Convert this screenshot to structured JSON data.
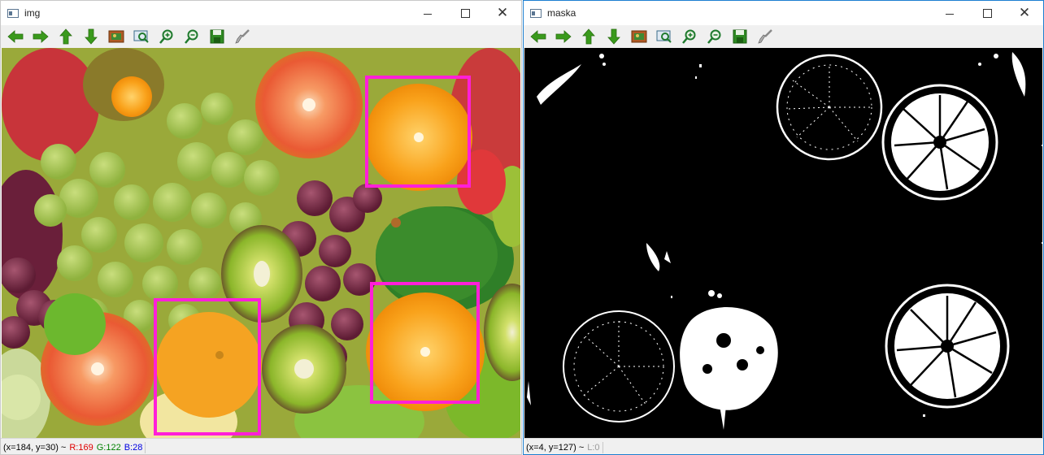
{
  "windows": {
    "left": {
      "title": "img",
      "status": {
        "coords": "(x=184, y=30) ~",
        "r": "R:169",
        "g": "G:122",
        "b": "B:28"
      }
    },
    "right": {
      "title": "maska",
      "status": {
        "coords": "(x=4, y=127) ~",
        "l": "L:0"
      }
    }
  },
  "toolbar_icons": [
    "arrow-left-icon",
    "arrow-right-icon",
    "arrow-up-icon",
    "arrow-down-icon",
    "image-icon",
    "zoom-fit-icon",
    "zoom-in-icon",
    "zoom-out-icon",
    "save-icon",
    "properties-brush-icon"
  ],
  "colors": {
    "detection_box": "#ff1fd8",
    "toolbar_arrow": "#3a9a1c",
    "status_r": "#e00000",
    "status_g": "#008000",
    "status_b": "#0000e0"
  }
}
